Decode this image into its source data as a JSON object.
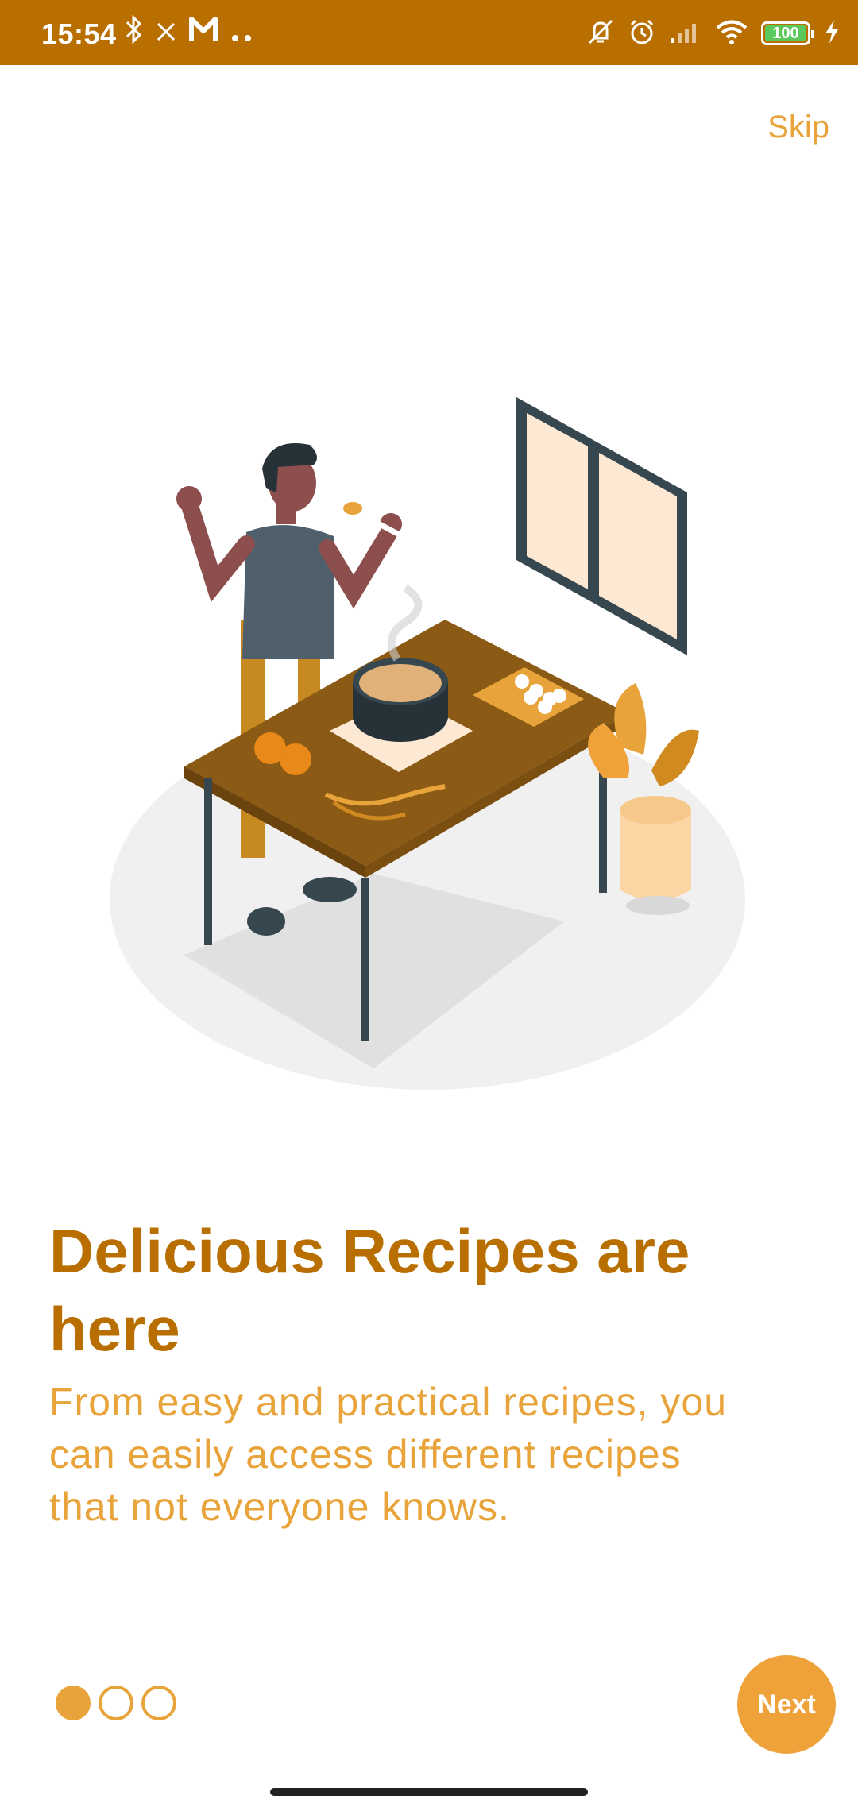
{
  "status_bar": {
    "time": "15:54",
    "left_icons": [
      "bluetooth-icon",
      "close-icon",
      "gmail-icon",
      "more-icon"
    ],
    "right_icons": [
      "mute-icon",
      "alarm-icon",
      "signal-icon",
      "wifi-icon",
      "battery-icon",
      "charging-icon"
    ],
    "battery_level": "100"
  },
  "top": {
    "skip_label": "Skip"
  },
  "onboarding": {
    "title": "Delicious Recipes are here",
    "description": "From easy and practical recipes, you can easily access different recipes that not everyone knows.",
    "page_index": 0,
    "page_count": 3
  },
  "actions": {
    "next_label": "Next"
  },
  "colors": {
    "status_bar": "#b86f00",
    "accent": "#e8a43a",
    "title": "#b86f00",
    "next_button": "#f0a23a"
  }
}
